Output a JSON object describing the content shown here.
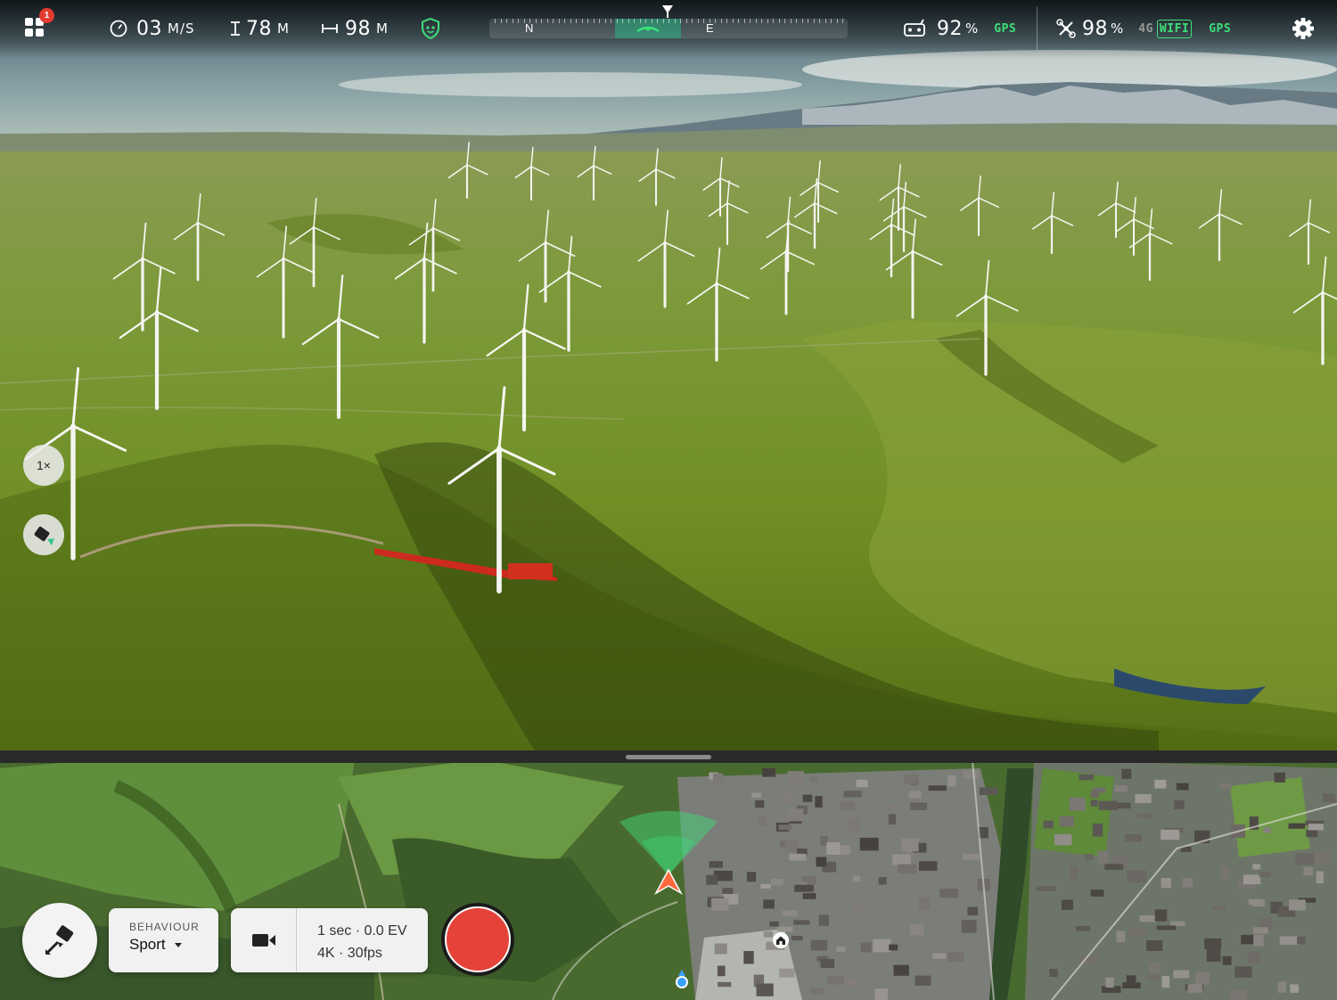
{
  "hud": {
    "apps_badge": "1",
    "speed_value": "03",
    "speed_unit": "M/S",
    "altitude_value": "78",
    "altitude_unit": "M",
    "distance_value": "98",
    "distance_unit": "M",
    "compass": {
      "north": "N",
      "east": "E"
    },
    "controller_battery_value": "92",
    "controller_battery_unit": "%",
    "controller_gps": "GPS",
    "drone_battery_value": "98",
    "drone_battery_unit": "%",
    "network_4g": "4G",
    "wifi_label": "WIFI",
    "drone_gps": "GPS"
  },
  "controls": {
    "zoom_label": "1×"
  },
  "bottom": {
    "behaviour_caption": "BEHAVIOUR",
    "behaviour_value": "Sport",
    "camera_line1": "1 sec · 0.0 EV",
    "camera_line2": "4K · 30fps"
  },
  "colors": {
    "accent_green": "#3ee07a",
    "record_red": "#e5433a",
    "badge_red": "#e23b2e",
    "drone_marker": "#ff6a3d"
  },
  "icons": [
    "apps-grid-icon",
    "speedometer-icon",
    "altitude-icon",
    "distance-icon",
    "shield-icon",
    "controller-icon",
    "drone-icon",
    "gear-icon",
    "gimbal-satellite-icon",
    "takeoff-drone-icon",
    "video-camera-icon",
    "home-icon"
  ]
}
